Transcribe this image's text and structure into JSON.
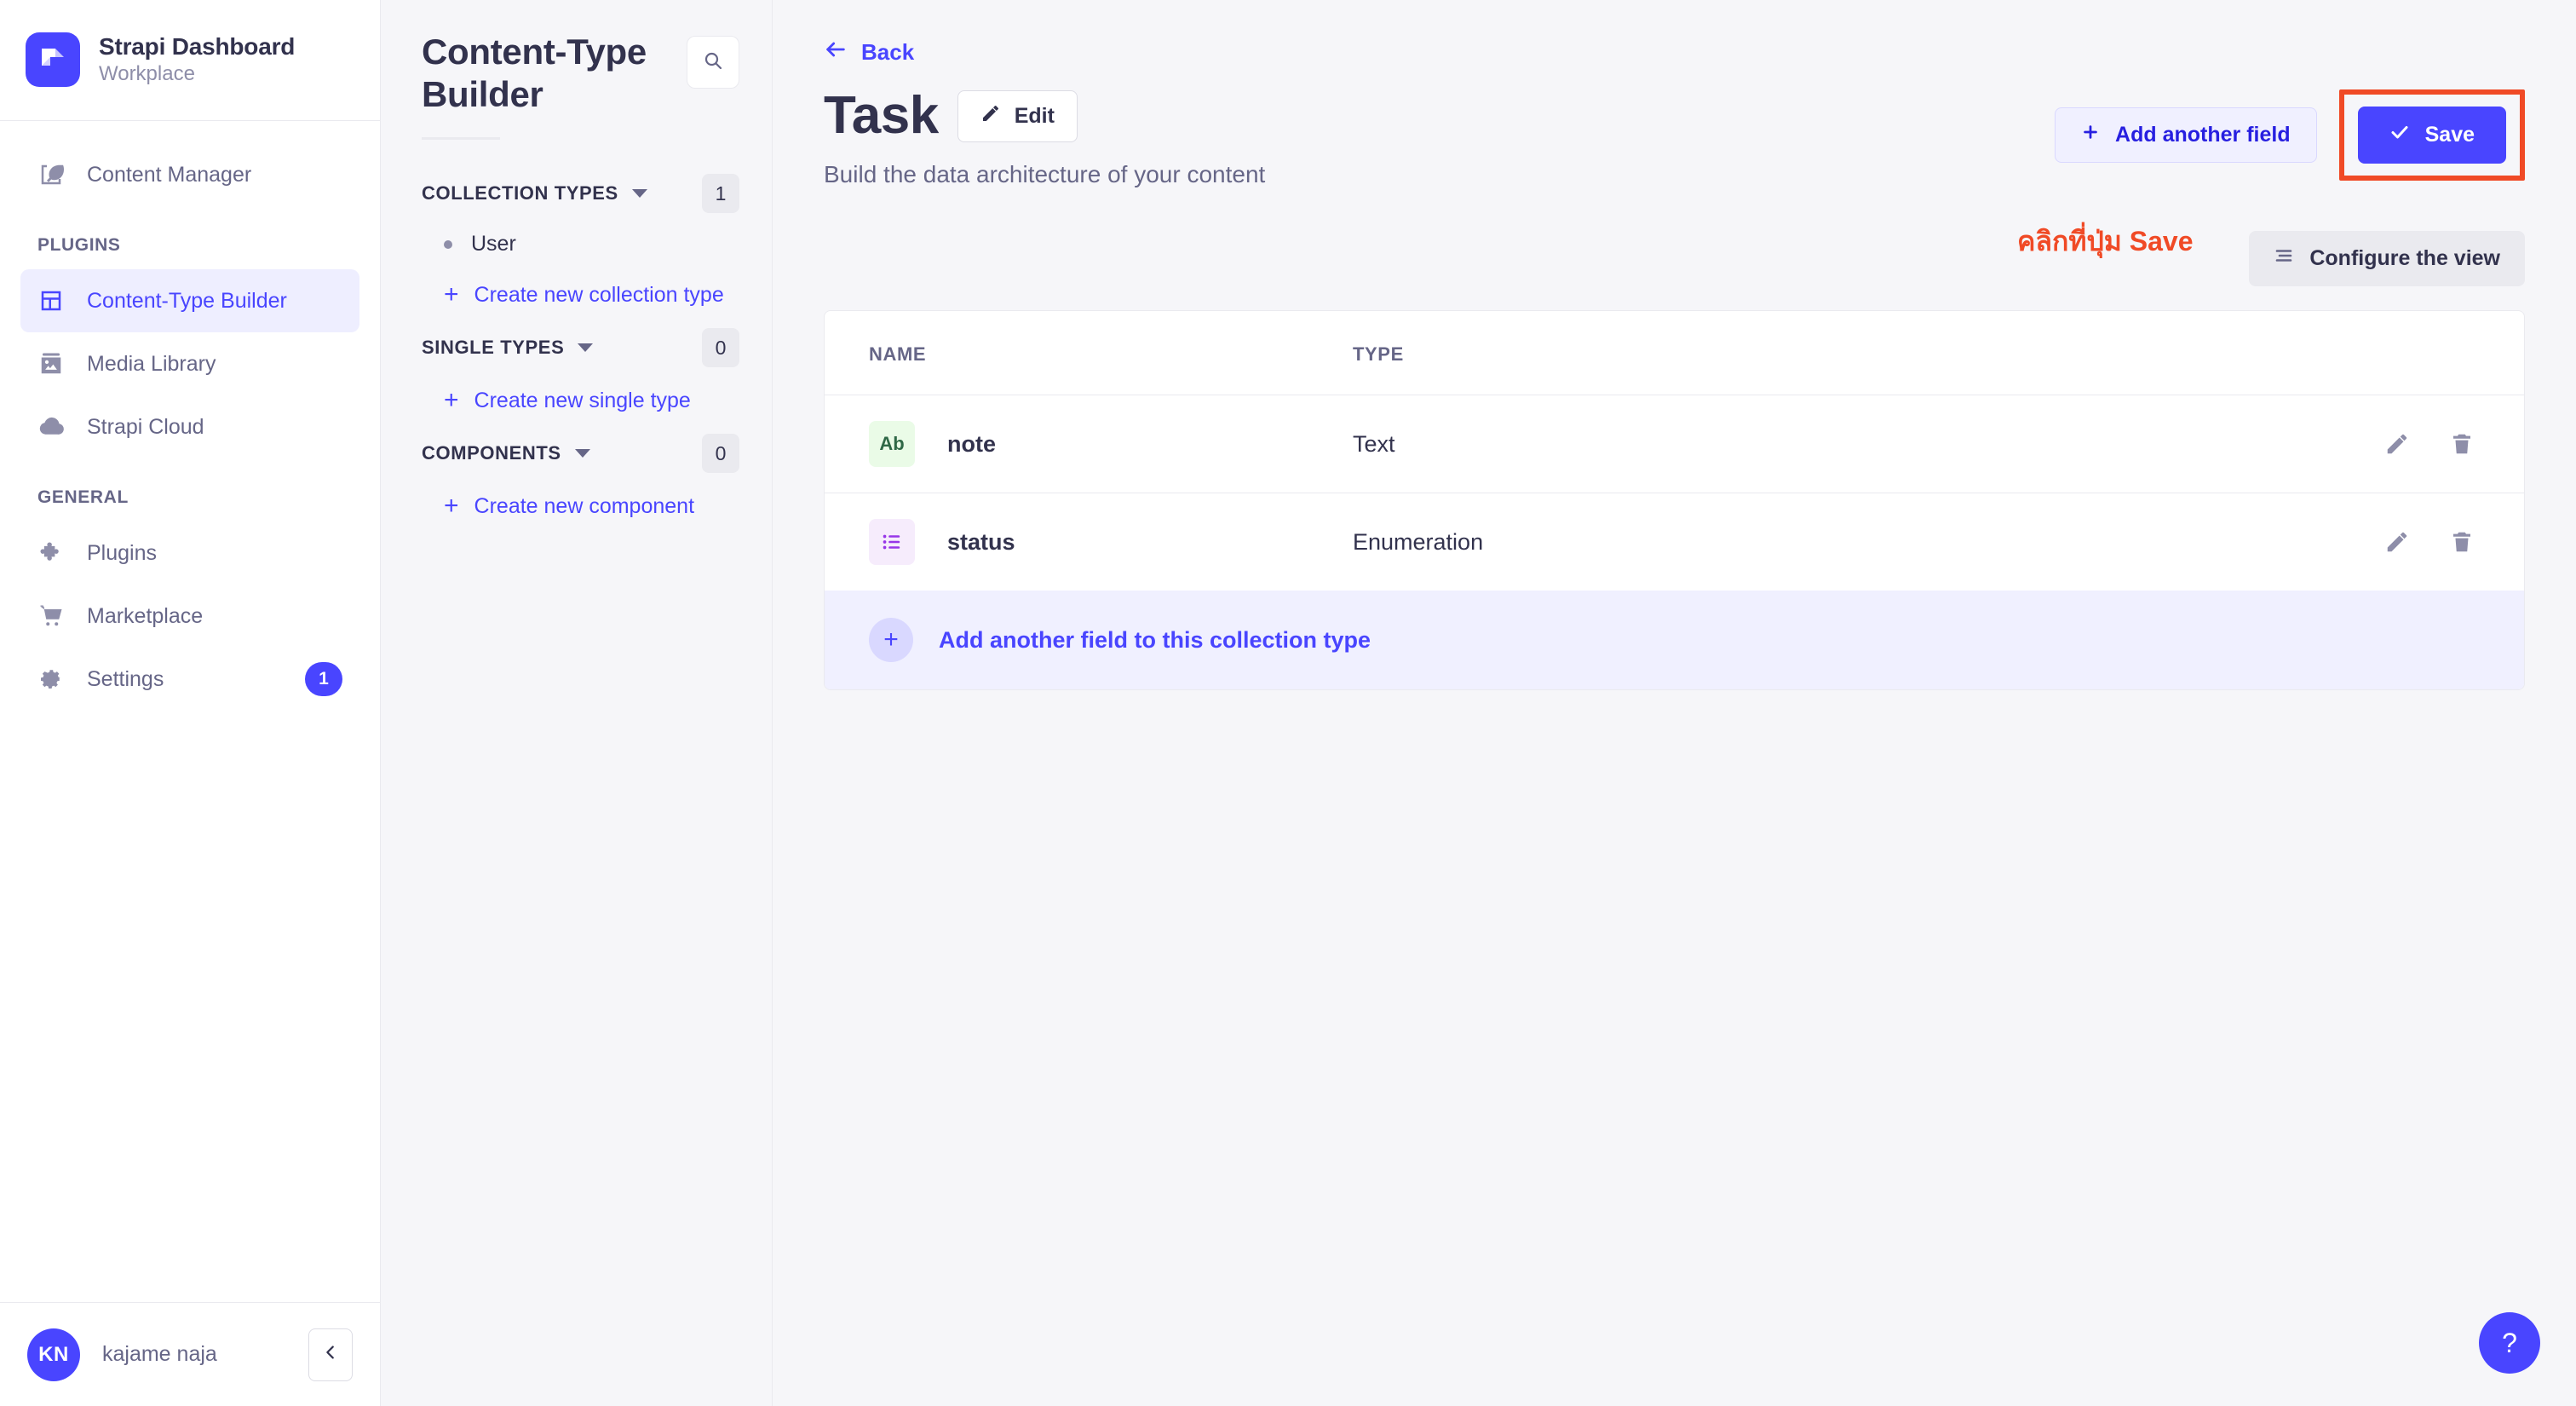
{
  "brand": {
    "title": "Strapi Dashboard",
    "subtitle": "Workplace",
    "logo_icon": "strapi-logo-icon",
    "accent_color": "#4945ff"
  },
  "sidebar": {
    "items": [
      {
        "label": "Content Manager",
        "icon": "feather-icon",
        "active": false
      },
      {
        "label": "Content-Type Builder",
        "icon": "layout-grid-icon",
        "active": true
      },
      {
        "label": "Media Library",
        "icon": "image-icon",
        "active": false
      },
      {
        "label": "Strapi Cloud",
        "icon": "cloud-icon",
        "active": false
      },
      {
        "label": "Plugins",
        "icon": "puzzle-icon",
        "active": false
      },
      {
        "label": "Marketplace",
        "icon": "shopping-cart-icon",
        "active": false
      },
      {
        "label": "Settings",
        "icon": "gear-icon",
        "active": false,
        "badge": "1"
      }
    ],
    "sections": {
      "plugins": "PLUGINS",
      "general": "GENERAL"
    },
    "footer": {
      "avatar_initials": "KN",
      "username": "kajame naja",
      "collapse_icon": "chevron-left-icon"
    }
  },
  "subnav": {
    "title": "Content-Type Builder",
    "search_icon": "search-icon",
    "groups": [
      {
        "label": "COLLECTION TYPES",
        "count": "1",
        "items": [
          {
            "label": "User"
          }
        ],
        "create_label": "Create new collection type"
      },
      {
        "label": "SINGLE TYPES",
        "count": "0",
        "items": [],
        "create_label": "Create new single type"
      },
      {
        "label": "COMPONENTS",
        "count": "0",
        "items": [],
        "create_label": "Create new component"
      }
    ]
  },
  "main": {
    "back_label": "Back",
    "page_title": "Task",
    "edit_label": "Edit",
    "subtitle": "Build the data architecture of your content",
    "add_field_label": "Add another field",
    "save_label": "Save",
    "configure_label": "Configure the view",
    "table": {
      "columns": [
        "NAME",
        "TYPE"
      ],
      "rows": [
        {
          "chip": "Ab",
          "chip_kind": "text",
          "name": "note",
          "type": "Text"
        },
        {
          "chip": "list",
          "chip_kind": "enum",
          "name": "status",
          "type": "Enumeration"
        }
      ],
      "edit_icon": "pencil-icon",
      "delete_icon": "trash-icon"
    },
    "add_field_row_label": "Add another field to this collection type",
    "help_label": "?"
  },
  "annotation": {
    "text": "คลิกที่ปุ่ม Save",
    "color": "#f04a26",
    "highlight_target": "save-button"
  }
}
